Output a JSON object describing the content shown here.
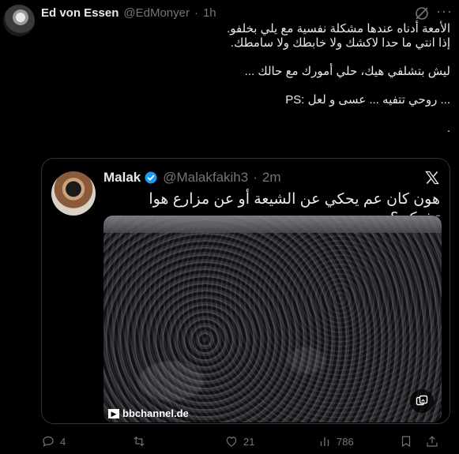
{
  "author": {
    "name": "Ed von Essen",
    "handle": "@EdMonyer",
    "separator": "·",
    "time": "1h"
  },
  "icons": {
    "grok": "grok-icon",
    "more": "more-icon"
  },
  "tweet": {
    "lines": [
      "الأمعة أدناه عندها مشكلة نفسية مع يلي بخلفو.",
      "إذا انتي ما حدا لاكشك ولا خابطك ولا سامطك.",
      "",
      "ليش بتشلفي هيك، حلي أمورك مع حالك ...",
      "",
      "PS: روحي تتفيه ... عسى و لعل ...",
      "",
      "."
    ]
  },
  "quote": {
    "name": "Malak",
    "handle": "@Malakfakih3",
    "separator": "·",
    "time": "2m",
    "text": "هون كان عم يحكي عن الشيعة أو عن مزارع هوا تشيكن؟",
    "media": {
      "watermark": "bbchannel.de",
      "watermark_box": "▶"
    }
  },
  "actions": {
    "replies": "4",
    "reposts": "",
    "likes": "21",
    "views": "786"
  },
  "colors": {
    "background": "#000000",
    "text": "#e7e9ea",
    "muted": "#71767b",
    "border": "#2f3336",
    "verified": "#1d9bf0"
  }
}
